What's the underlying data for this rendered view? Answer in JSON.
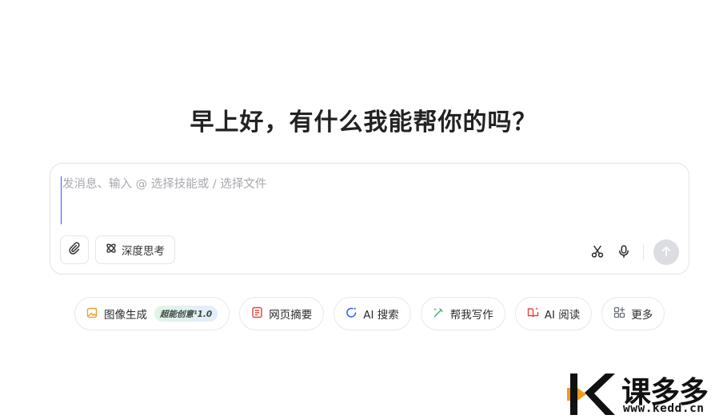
{
  "greeting": "早上好，有什么我能帮你的吗？",
  "composer": {
    "placeholder": "发消息、输入 @ 选择技能或 / 选择文件",
    "deep_think_label": "深度思考"
  },
  "skills": [
    {
      "icon": "image-icon",
      "label": "图像生成",
      "badge": "超能创意¹1.0",
      "color": "#e8a33c"
    },
    {
      "icon": "webpage-icon",
      "label": "网页摘要",
      "color": "#e2453d"
    },
    {
      "icon": "ai-search-icon",
      "label": "AI 搜索",
      "color": "#2f6bff"
    },
    {
      "icon": "pen-icon",
      "label": "帮我写作",
      "color": "#3bb36a"
    },
    {
      "icon": "reading-icon",
      "label": "AI 阅读",
      "color": "#e2453d"
    },
    {
      "icon": "grid-icon",
      "label": "更多",
      "color": "#6b6f79"
    }
  ],
  "watermark": {
    "title": "课多多",
    "url": "www.kedd.cn",
    "colors": {
      "orange": "#f29a1f",
      "dark": "#111111"
    }
  }
}
